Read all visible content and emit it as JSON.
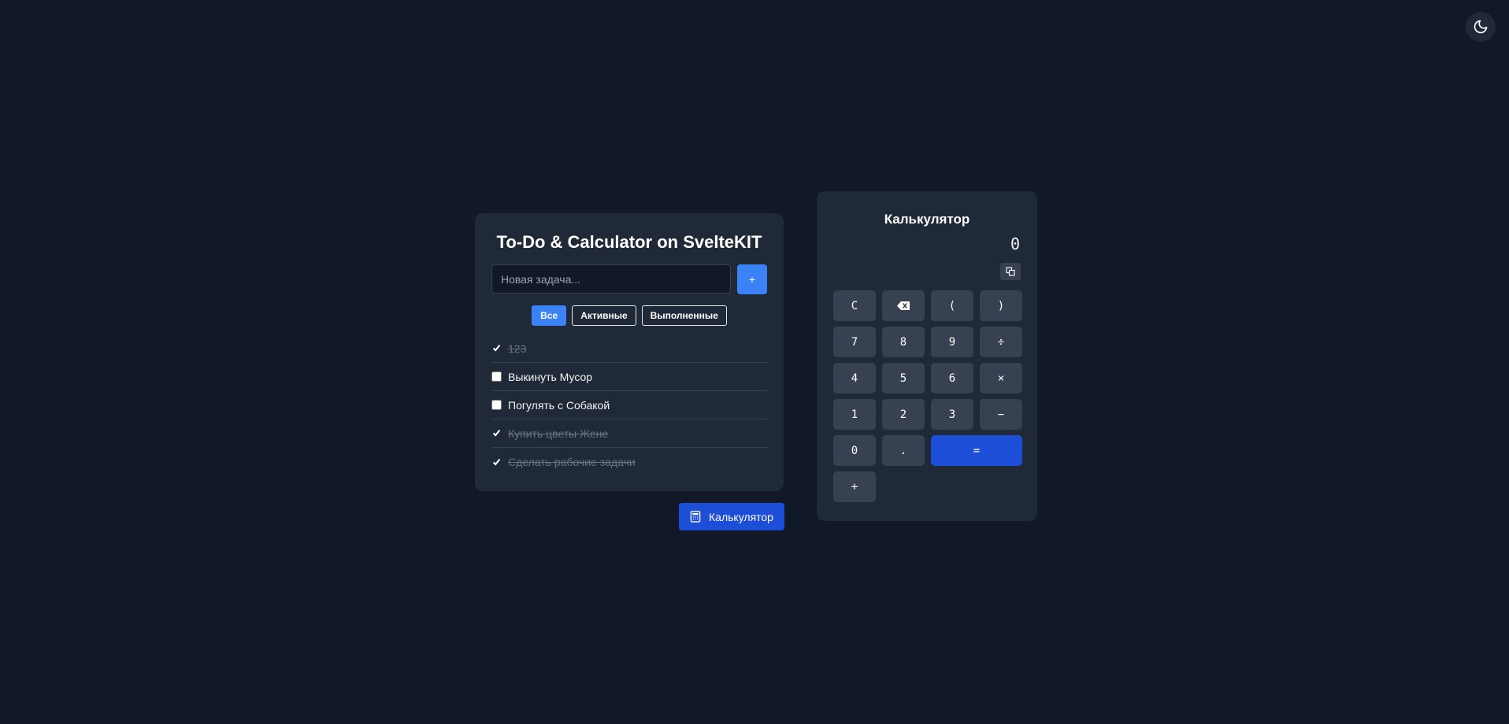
{
  "theme_toggle": {
    "icon": "moon-icon"
  },
  "todo": {
    "title": "To-Do & Calculator on SvelteKIT",
    "input_placeholder": "Новая задача...",
    "add_label": "+",
    "filters": [
      {
        "label": "Все",
        "active": true
      },
      {
        "label": "Активные",
        "active": false
      },
      {
        "label": "Выполненные",
        "active": false
      }
    ],
    "items": [
      {
        "text": "123",
        "done": true
      },
      {
        "text": "Выкинуть Мусор",
        "done": false
      },
      {
        "text": "Погулять с Собакой",
        "done": false
      },
      {
        "text": "Купить цветы Жене",
        "done": true
      },
      {
        "text": "Сделать рабочие задачи",
        "done": true
      }
    ]
  },
  "calc_toggle": {
    "label": "Калькулятор",
    "icon": "calculator-icon"
  },
  "calculator": {
    "title": "Калькулятор",
    "display": "0",
    "copy_icon": "copy-icon",
    "keys": {
      "clear": "C",
      "open_paren": "(",
      "close_paren": ")",
      "seven": "7",
      "eight": "8",
      "nine": "9",
      "divide": "÷",
      "four": "4",
      "five": "5",
      "six": "6",
      "multiply": "×",
      "one": "1",
      "two": "2",
      "three": "3",
      "minus": "−",
      "zero": "0",
      "dot": ".",
      "equals": "=",
      "plus": "+"
    }
  },
  "colors": {
    "background": "#111827",
    "card": "#1f2937",
    "key": "#374151",
    "accent": "#3b82f6",
    "accent_dark": "#1d4ed8"
  }
}
